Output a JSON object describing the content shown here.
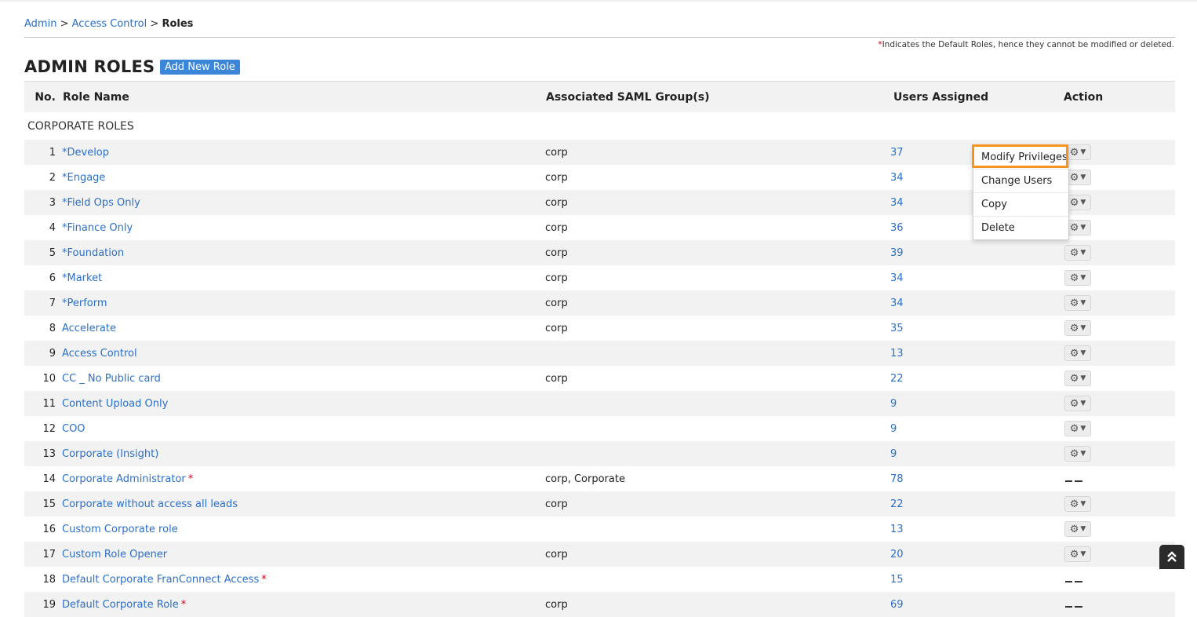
{
  "breadcrumb": {
    "admin": "Admin",
    "sep1": ">",
    "access": "Access Control",
    "sep2": ">",
    "current": "Roles"
  },
  "note": {
    "star": "*",
    "text": "Indicates the Default Roles, hence they cannot be modified or deleted."
  },
  "page_title": "ADMIN ROLES",
  "add_button": "Add New Role",
  "headers": {
    "no": "No.",
    "name": "Role Name",
    "saml": "Associated SAML Group(s)",
    "users": "Users Assigned",
    "action": "Action"
  },
  "section_label": "CORPORATE ROLES",
  "rows": [
    {
      "no": "1",
      "name": "*Develop",
      "saml": "corp",
      "users": "37",
      "action": "menu"
    },
    {
      "no": "2",
      "name": "*Engage",
      "saml": "corp",
      "users": "34",
      "action": "menu"
    },
    {
      "no": "3",
      "name": "*Field Ops Only",
      "saml": "corp",
      "users": "34",
      "action": "menu"
    },
    {
      "no": "4",
      "name": "*Finance Only",
      "saml": "corp",
      "users": "36",
      "action": "menu"
    },
    {
      "no": "5",
      "name": "*Foundation",
      "saml": "corp",
      "users": "39",
      "action": "menu"
    },
    {
      "no": "6",
      "name": "*Market",
      "saml": "corp",
      "users": "34",
      "action": "menu"
    },
    {
      "no": "7",
      "name": "*Perform",
      "saml": "corp",
      "users": "34",
      "action": "menu"
    },
    {
      "no": "8",
      "name": "Accelerate",
      "saml": "corp",
      "users": "35",
      "action": "menu"
    },
    {
      "no": "9",
      "name": "Access Control",
      "saml": "",
      "users": "13",
      "action": "menu"
    },
    {
      "no": "10",
      "name": "CC _ No Public card",
      "saml": "corp",
      "users": "22",
      "action": "menu"
    },
    {
      "no": "11",
      "name": "Content Upload Only",
      "saml": "",
      "users": "9",
      "action": "menu"
    },
    {
      "no": "12",
      "name": "COO",
      "saml": "",
      "users": "9",
      "action": "menu"
    },
    {
      "no": "13",
      "name": "Corporate (Insight)",
      "saml": "",
      "users": "9",
      "action": "menu"
    },
    {
      "no": "14",
      "name": "Corporate Administrator",
      "req": "*",
      "saml": "corp, Corporate",
      "users": "78",
      "action": "none"
    },
    {
      "no": "15",
      "name": "Corporate without access all leads",
      "saml": "corp",
      "users": "22",
      "action": "menu"
    },
    {
      "no": "16",
      "name": "Custom Corporate role",
      "saml": "",
      "users": "13",
      "action": "menu"
    },
    {
      "no": "17",
      "name": "Custom Role Opener",
      "saml": "corp",
      "users": "20",
      "action": "menu"
    },
    {
      "no": "18",
      "name": "Default Corporate FranConnect Access",
      "req": "*",
      "saml": "",
      "users": "15",
      "action": "none"
    },
    {
      "no": "19",
      "name": "Default Corporate Role",
      "req": "*",
      "saml": "corp",
      "users": "69",
      "action": "none"
    }
  ],
  "action_menu": {
    "items": [
      "Modify Privileges",
      "Change Users",
      "Copy",
      "Delete"
    ],
    "highlighted": "Modify Privileges"
  },
  "icons": {
    "gear": "gear-icon",
    "caret": "caret-down-icon",
    "scroll_top": "double-chevron-up-icon"
  },
  "colors": {
    "link": "#2a6fc9",
    "button": "#3b86d9",
    "highlight": "#f7931e",
    "required": "#d0021b"
  }
}
